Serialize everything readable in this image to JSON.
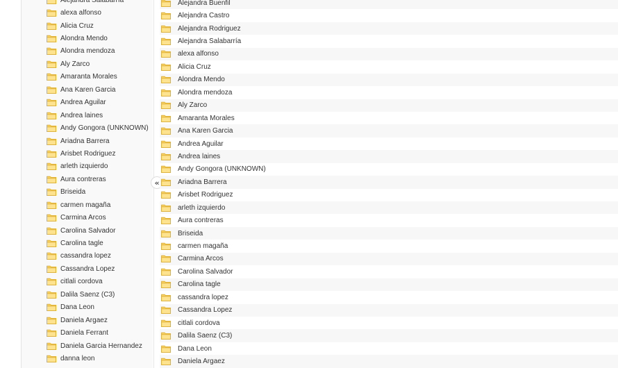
{
  "colors": {
    "folder_fill": "#fad76a",
    "folder_stroke": "#d9a92b",
    "stripe": "#f7f7f7",
    "sidebar_bg": "#f9f9f9"
  },
  "icons": {
    "folder": "folder-icon",
    "collapse": "collapse-chevron-icon"
  },
  "collapse_button": {
    "label": "«"
  },
  "sidebar": {
    "items": [
      "Alejandra Salabarría",
      "alexa alfonso",
      "Alicia Cruz",
      "Alondra Mendo",
      "Alondra mendoza",
      "Aly Zarco",
      "Amaranta Morales",
      "Ana Karen Garcia",
      "Andrea Aguilar",
      "Andrea laines",
      "Andy Gongora (UNKNOWN)",
      "Ariadna Barrera",
      "Arisbet Rodriguez",
      "arleth izquierdo",
      "Aura contreras",
      "Briseida",
      "carmen magaña",
      "Carmina Arcos",
      "Carolina Salvador",
      "Carolina tagle",
      "cassandra lopez",
      "Cassandra Lopez",
      "citlali cordova",
      "Dalila Saenz (C3)",
      "Dana Leon",
      "Daniela Argaez",
      "Daniela Ferrant",
      "Daniela Garcia Hernandez",
      "danna leon"
    ]
  },
  "main": {
    "rows": [
      "Alejandra Buenfil",
      "Alejandra Castro",
      "Alejandra Rodriguez",
      "Alejandra Salabarría",
      "alexa alfonso",
      "Alicia Cruz",
      "Alondra Mendo",
      "Alondra mendoza",
      "Aly Zarco",
      "Amaranta Morales",
      "Ana Karen Garcia",
      "Andrea Aguilar",
      "Andrea laines",
      "Andy Gongora (UNKNOWN)",
      "Ariadna Barrera",
      "Arisbet Rodriguez",
      "arleth izquierdo",
      "Aura contreras",
      "Briseida",
      "carmen magaña",
      "Carmina Arcos",
      "Carolina Salvador",
      "Carolina tagle",
      "cassandra lopez",
      "Cassandra Lopez",
      "citlali cordova",
      "Dalila Saenz (C3)",
      "Dana Leon",
      "Daniela Argaez"
    ]
  }
}
